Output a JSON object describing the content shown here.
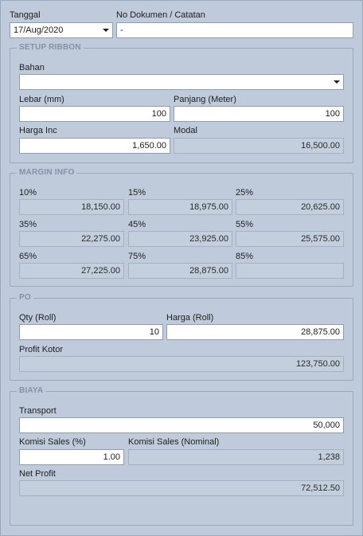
{
  "header": {
    "tanggal_label": "Tanggal",
    "tanggal_value": "17/Aug/2020",
    "dokumen_label": "No Dokumen / Catatan",
    "dokumen_value": "-"
  },
  "setup_ribbon": {
    "title": "SETUP RIBBON",
    "bahan_label": "Bahan",
    "bahan_value": "",
    "lebar_label": "Lebar (mm)",
    "lebar_value": "100",
    "panjang_label": "Panjang (Meter)",
    "panjang_value": "100",
    "harga_label": "Harga Inc",
    "harga_value": "1,650.00",
    "modal_label": "Modal",
    "modal_value": "16,500.00"
  },
  "margin_info": {
    "title": "MARGIN INFO",
    "items": [
      {
        "label": "10%",
        "value": "18,150.00"
      },
      {
        "label": "15%",
        "value": "18,975.00"
      },
      {
        "label": "25%",
        "value": "20,625.00"
      },
      {
        "label": "35%",
        "value": "22,275.00"
      },
      {
        "label": "45%",
        "value": "23,925.00"
      },
      {
        "label": "55%",
        "value": "25,575.00"
      },
      {
        "label": "65%",
        "value": "27,225.00"
      },
      {
        "label": "75%",
        "value": "28,875.00"
      },
      {
        "label": "85%",
        "value": ""
      }
    ]
  },
  "po": {
    "title": "PO",
    "qty_label": "Qty (Roll)",
    "qty_value": "10",
    "harga_label": "Harga (Roll)",
    "harga_value": "28,875.00",
    "profit_label": "Profit Kotor",
    "profit_value": "123,750.00"
  },
  "biaya": {
    "title": "BIAYA",
    "transport_label": "Transport",
    "transport_value": "50,000",
    "komisi_pct_label": "Komisi Sales (%)",
    "komisi_pct_value": "1.00",
    "komisi_nom_label": "Komisi Sales (Nominal)",
    "komisi_nom_value": "1,238",
    "net_label": "Net Profit",
    "net_value": "72,512.50"
  },
  "colors": {
    "background": "#bfcbdb",
    "group_title": "#8592a6",
    "readonly_field": "#c4cfdd",
    "edit_field": "#ffffff"
  }
}
